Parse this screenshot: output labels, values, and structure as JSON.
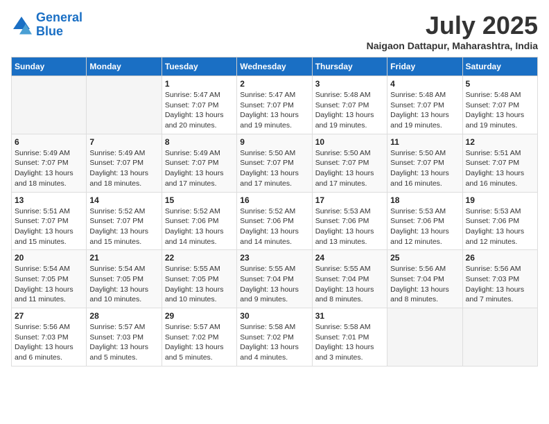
{
  "header": {
    "logo_line1": "General",
    "logo_line2": "Blue",
    "month_title": "July 2025",
    "location": "Naigaon Dattapur, Maharashtra, India"
  },
  "columns": [
    "Sunday",
    "Monday",
    "Tuesday",
    "Wednesday",
    "Thursday",
    "Friday",
    "Saturday"
  ],
  "weeks": [
    [
      {
        "num": "",
        "info": ""
      },
      {
        "num": "",
        "info": ""
      },
      {
        "num": "1",
        "info": "Sunrise: 5:47 AM\nSunset: 7:07 PM\nDaylight: 13 hours\nand 20 minutes."
      },
      {
        "num": "2",
        "info": "Sunrise: 5:47 AM\nSunset: 7:07 PM\nDaylight: 13 hours\nand 19 minutes."
      },
      {
        "num": "3",
        "info": "Sunrise: 5:48 AM\nSunset: 7:07 PM\nDaylight: 13 hours\nand 19 minutes."
      },
      {
        "num": "4",
        "info": "Sunrise: 5:48 AM\nSunset: 7:07 PM\nDaylight: 13 hours\nand 19 minutes."
      },
      {
        "num": "5",
        "info": "Sunrise: 5:48 AM\nSunset: 7:07 PM\nDaylight: 13 hours\nand 19 minutes."
      }
    ],
    [
      {
        "num": "6",
        "info": "Sunrise: 5:49 AM\nSunset: 7:07 PM\nDaylight: 13 hours\nand 18 minutes."
      },
      {
        "num": "7",
        "info": "Sunrise: 5:49 AM\nSunset: 7:07 PM\nDaylight: 13 hours\nand 18 minutes."
      },
      {
        "num": "8",
        "info": "Sunrise: 5:49 AM\nSunset: 7:07 PM\nDaylight: 13 hours\nand 17 minutes."
      },
      {
        "num": "9",
        "info": "Sunrise: 5:50 AM\nSunset: 7:07 PM\nDaylight: 13 hours\nand 17 minutes."
      },
      {
        "num": "10",
        "info": "Sunrise: 5:50 AM\nSunset: 7:07 PM\nDaylight: 13 hours\nand 17 minutes."
      },
      {
        "num": "11",
        "info": "Sunrise: 5:50 AM\nSunset: 7:07 PM\nDaylight: 13 hours\nand 16 minutes."
      },
      {
        "num": "12",
        "info": "Sunrise: 5:51 AM\nSunset: 7:07 PM\nDaylight: 13 hours\nand 16 minutes."
      }
    ],
    [
      {
        "num": "13",
        "info": "Sunrise: 5:51 AM\nSunset: 7:07 PM\nDaylight: 13 hours\nand 15 minutes."
      },
      {
        "num": "14",
        "info": "Sunrise: 5:52 AM\nSunset: 7:07 PM\nDaylight: 13 hours\nand 15 minutes."
      },
      {
        "num": "15",
        "info": "Sunrise: 5:52 AM\nSunset: 7:06 PM\nDaylight: 13 hours\nand 14 minutes."
      },
      {
        "num": "16",
        "info": "Sunrise: 5:52 AM\nSunset: 7:06 PM\nDaylight: 13 hours\nand 14 minutes."
      },
      {
        "num": "17",
        "info": "Sunrise: 5:53 AM\nSunset: 7:06 PM\nDaylight: 13 hours\nand 13 minutes."
      },
      {
        "num": "18",
        "info": "Sunrise: 5:53 AM\nSunset: 7:06 PM\nDaylight: 13 hours\nand 12 minutes."
      },
      {
        "num": "19",
        "info": "Sunrise: 5:53 AM\nSunset: 7:06 PM\nDaylight: 13 hours\nand 12 minutes."
      }
    ],
    [
      {
        "num": "20",
        "info": "Sunrise: 5:54 AM\nSunset: 7:05 PM\nDaylight: 13 hours\nand 11 minutes."
      },
      {
        "num": "21",
        "info": "Sunrise: 5:54 AM\nSunset: 7:05 PM\nDaylight: 13 hours\nand 10 minutes."
      },
      {
        "num": "22",
        "info": "Sunrise: 5:55 AM\nSunset: 7:05 PM\nDaylight: 13 hours\nand 10 minutes."
      },
      {
        "num": "23",
        "info": "Sunrise: 5:55 AM\nSunset: 7:04 PM\nDaylight: 13 hours\nand 9 minutes."
      },
      {
        "num": "24",
        "info": "Sunrise: 5:55 AM\nSunset: 7:04 PM\nDaylight: 13 hours\nand 8 minutes."
      },
      {
        "num": "25",
        "info": "Sunrise: 5:56 AM\nSunset: 7:04 PM\nDaylight: 13 hours\nand 8 minutes."
      },
      {
        "num": "26",
        "info": "Sunrise: 5:56 AM\nSunset: 7:03 PM\nDaylight: 13 hours\nand 7 minutes."
      }
    ],
    [
      {
        "num": "27",
        "info": "Sunrise: 5:56 AM\nSunset: 7:03 PM\nDaylight: 13 hours\nand 6 minutes."
      },
      {
        "num": "28",
        "info": "Sunrise: 5:57 AM\nSunset: 7:03 PM\nDaylight: 13 hours\nand 5 minutes."
      },
      {
        "num": "29",
        "info": "Sunrise: 5:57 AM\nSunset: 7:02 PM\nDaylight: 13 hours\nand 5 minutes."
      },
      {
        "num": "30",
        "info": "Sunrise: 5:58 AM\nSunset: 7:02 PM\nDaylight: 13 hours\nand 4 minutes."
      },
      {
        "num": "31",
        "info": "Sunrise: 5:58 AM\nSunset: 7:01 PM\nDaylight: 13 hours\nand 3 minutes."
      },
      {
        "num": "",
        "info": ""
      },
      {
        "num": "",
        "info": ""
      }
    ]
  ]
}
